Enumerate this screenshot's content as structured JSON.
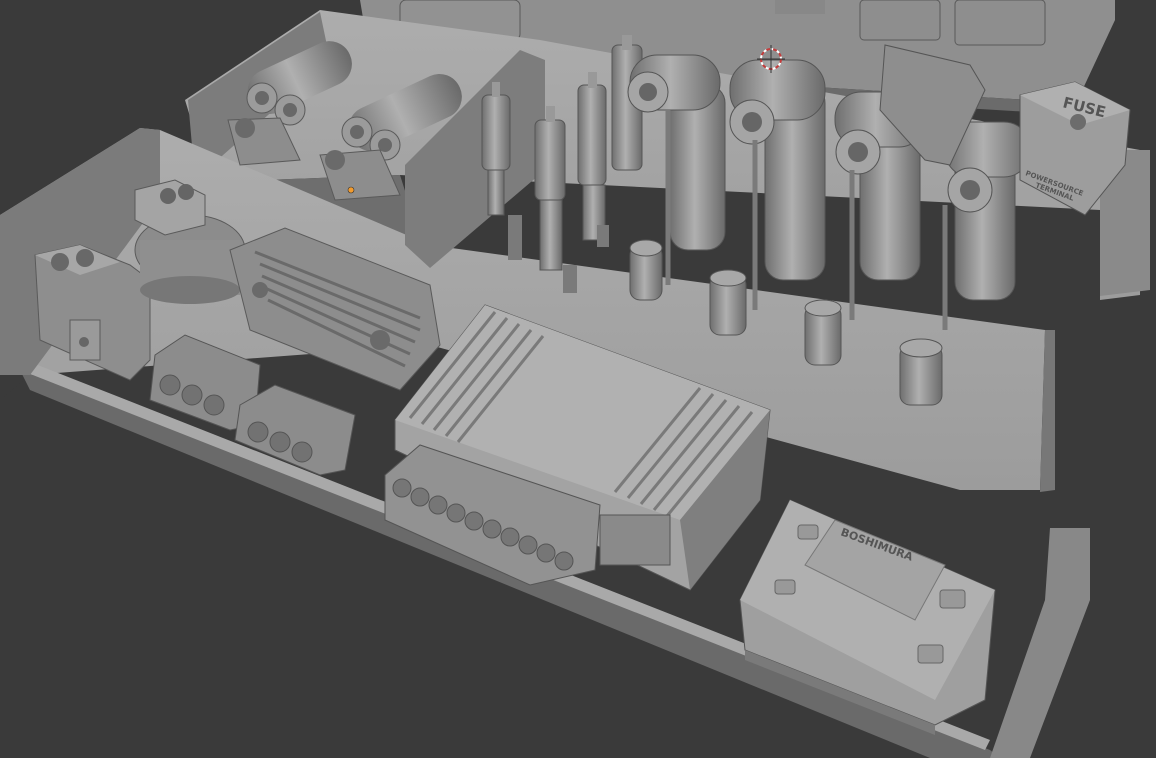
{
  "viewport": {
    "background": "#3a3a3a",
    "mesh_color": "#9a9a9a",
    "axis_color": "#6fa534",
    "cursor_icon": "3d-cursor-icon"
  },
  "labels": {
    "fuse": "FUSE",
    "terminal_line1": "POWERSOURCE",
    "terminal_line2": "TERMINAL",
    "module_brand": "BOSHIMURA"
  }
}
